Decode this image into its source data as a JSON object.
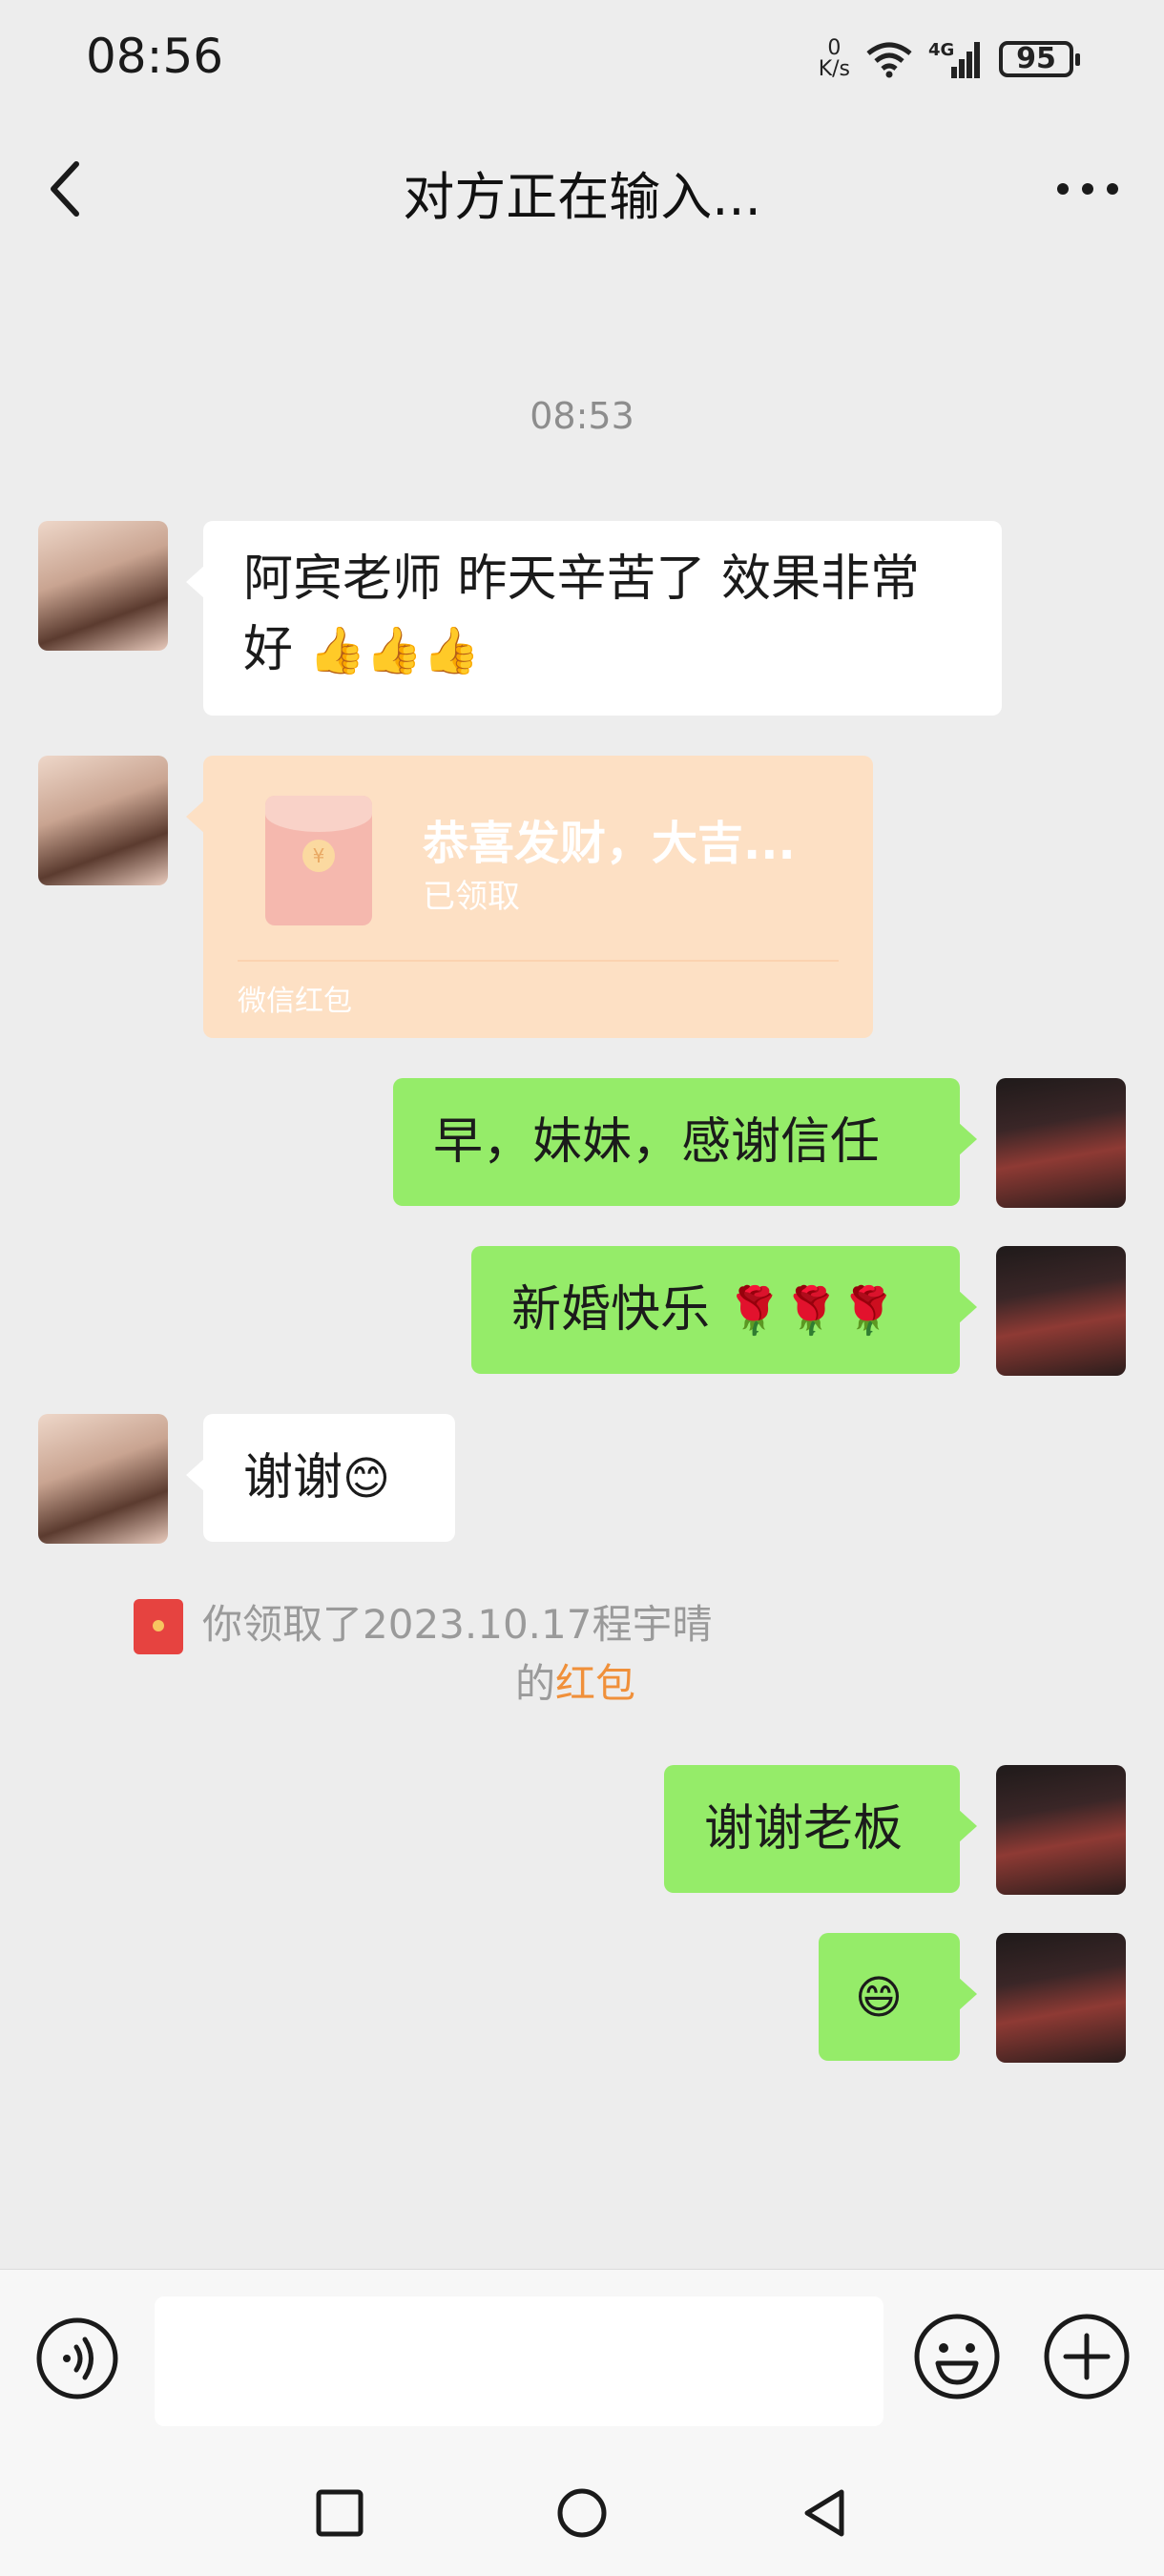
{
  "status_bar": {
    "time": "08:56",
    "net_speed_value": "0",
    "net_speed_unit": "K/s",
    "network": "4G",
    "battery": "95"
  },
  "header": {
    "title": "对方正在输入..."
  },
  "chat": {
    "timestamp": "08:53",
    "messages": [
      {
        "side": "left",
        "text": "阿宾老师 昨天辛苦了 效果非常好",
        "emoji": "👍👍👍"
      },
      {
        "side": "left",
        "type": "red_packet",
        "title": "恭喜发财，大吉...",
        "status": "已领取",
        "brand": "微信红包"
      },
      {
        "side": "right",
        "text": "早，妹妹，感谢信任"
      },
      {
        "side": "right",
        "text": "新婚快乐",
        "emoji": "🌹🌹🌹"
      },
      {
        "side": "left",
        "text": "谢谢",
        "emoji": "😊"
      },
      {
        "side": "right",
        "text": "谢谢老板"
      },
      {
        "side": "right",
        "emoji": "😄"
      }
    ],
    "notice": {
      "line1": "你领取了2023.10.17程宇晴",
      "line2_prefix": "的",
      "line2_link": "红包"
    }
  },
  "input_bar": {
    "placeholder": ""
  },
  "icons": {
    "back": "chevron-left-icon",
    "more": "more-dots-icon",
    "voice": "voice-icon",
    "emoji": "emoji-icon",
    "plus": "plus-icon",
    "nav_recent": "square-icon",
    "nav_home": "circle-icon",
    "nav_back": "triangle-back-icon"
  },
  "colors": {
    "background": "#ededed",
    "bubble_green": "#95ec69",
    "bubble_white": "#ffffff",
    "red_packet": "#fde0c4",
    "link_orange": "#f0903a"
  }
}
